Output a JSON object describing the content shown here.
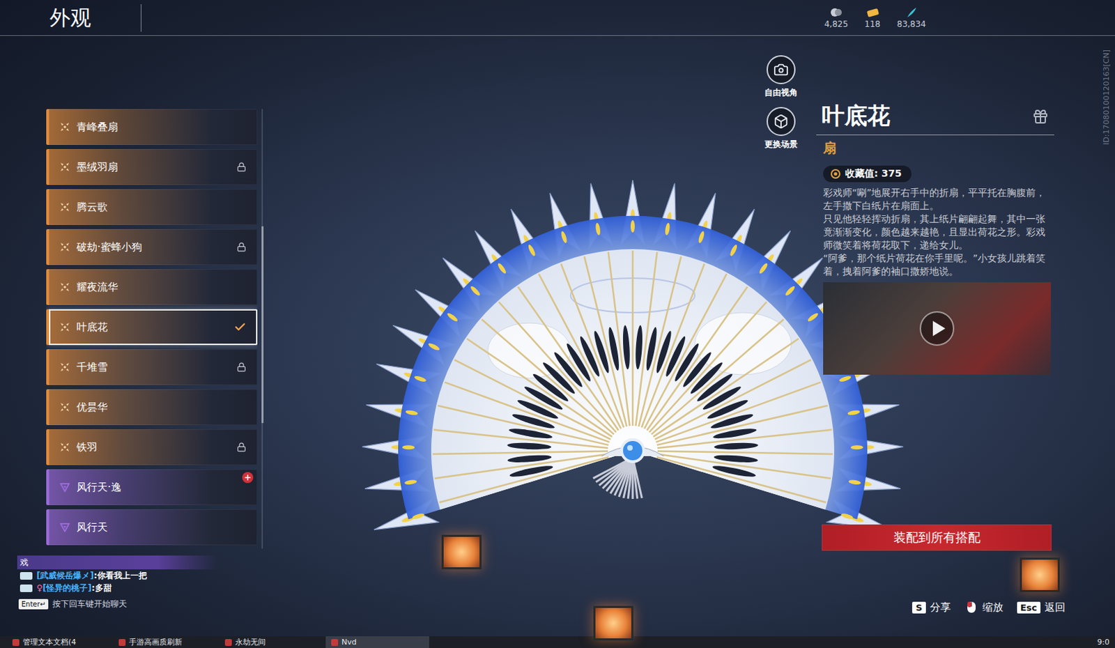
{
  "window": {
    "title": "外观"
  },
  "currencies": [
    {
      "amount": "4,825",
      "kind": "coin"
    },
    {
      "amount": "118",
      "kind": "ticket"
    },
    {
      "amount": "83,834",
      "kind": "feather"
    }
  ],
  "player_id": "ID:17080100120163[CN]",
  "appearance_list": {
    "items": [
      {
        "name": "青峰叠扇",
        "kind": "orange",
        "color": "#e08a3a",
        "locked": false,
        "selected": false,
        "badge": false
      },
      {
        "name": "墨绒羽扇",
        "kind": "orange",
        "color": "#e08a3a",
        "locked": true,
        "selected": false,
        "badge": false
      },
      {
        "name": "腾云歌",
        "kind": "orange",
        "color": "#e08a3a",
        "locked": false,
        "selected": false,
        "badge": false
      },
      {
        "name": "破劫·蜜蜂小狗",
        "kind": "orange",
        "color": "#e08a3a",
        "locked": true,
        "selected": false,
        "badge": false
      },
      {
        "name": "耀夜流华",
        "kind": "orange",
        "color": "#e08a3a",
        "locked": false,
        "selected": false,
        "badge": false
      },
      {
        "name": "叶底花",
        "kind": "orange",
        "color": "#e08a3a",
        "locked": false,
        "selected": true,
        "badge": false
      },
      {
        "name": "千堆雪",
        "kind": "orange",
        "color": "#e08a3a",
        "locked": true,
        "selected": false,
        "badge": false
      },
      {
        "name": "优昙华",
        "kind": "orange",
        "color": "#e08a3a",
        "locked": false,
        "selected": false,
        "badge": false
      },
      {
        "name": "铁羽",
        "kind": "orange",
        "color": "#e08a3a",
        "locked": true,
        "selected": false,
        "badge": false
      },
      {
        "name": "风行天·逸",
        "kind": "purple",
        "color": "#9a6ad8",
        "locked": false,
        "selected": false,
        "badge": true
      },
      {
        "name": "风行天",
        "kind": "purple",
        "color": "#9a6ad8",
        "locked": false,
        "selected": false,
        "badge": false
      }
    ]
  },
  "tools": [
    {
      "label": "自由视角",
      "kind": "camera"
    },
    {
      "label": "更换场景",
      "kind": "scene"
    }
  ],
  "detail": {
    "title": "叶底花",
    "type": "扇",
    "collection_label": "收藏值:",
    "collection_value": "375",
    "description": [
      "彩戏师“唰”地展开右手中的折扇，平平托在胸腹前，左手撒下白纸片在扇面上。",
      "只见他轻轻挥动折扇，其上纸片翩翩起舞，其中一张竟渐渐变化，颜色越来越艳，且显出荷花之形。彩戏师微笑着将荷花取下，递给女儿。",
      "“阿爹，那个纸片荷花在你手里呢。”小女孩儿跳着笑着，拽着阿爹的袖口撒娇地说。"
    ],
    "button": "装配到所有搭配"
  },
  "chat": {
    "channel": "戏",
    "messages": [
      {
        "name": "[武威候岳爆メ]",
        "gender": "",
        "text": ":你看我上一把"
      },
      {
        "name": "[怪异的桃子]",
        "gender": "♀",
        "text": ":多甜"
      }
    ],
    "enter_key": "Enter↵",
    "hint": "按下回车键开始聊天"
  },
  "hints": [
    {
      "kind": "key",
      "key": "S",
      "label": "分享"
    },
    {
      "kind": "mouse",
      "label": "缩放"
    },
    {
      "kind": "key",
      "key": "Esc",
      "label": "返回"
    }
  ],
  "taskbar": {
    "items": [
      {
        "label": "管理文本文档(4",
        "selected": false
      },
      {
        "label": "手游高画质刷新",
        "selected": false
      },
      {
        "label": "永劫无间",
        "selected": false
      },
      {
        "label": "Nvd",
        "selected": true
      }
    ],
    "clock": "9:0"
  }
}
